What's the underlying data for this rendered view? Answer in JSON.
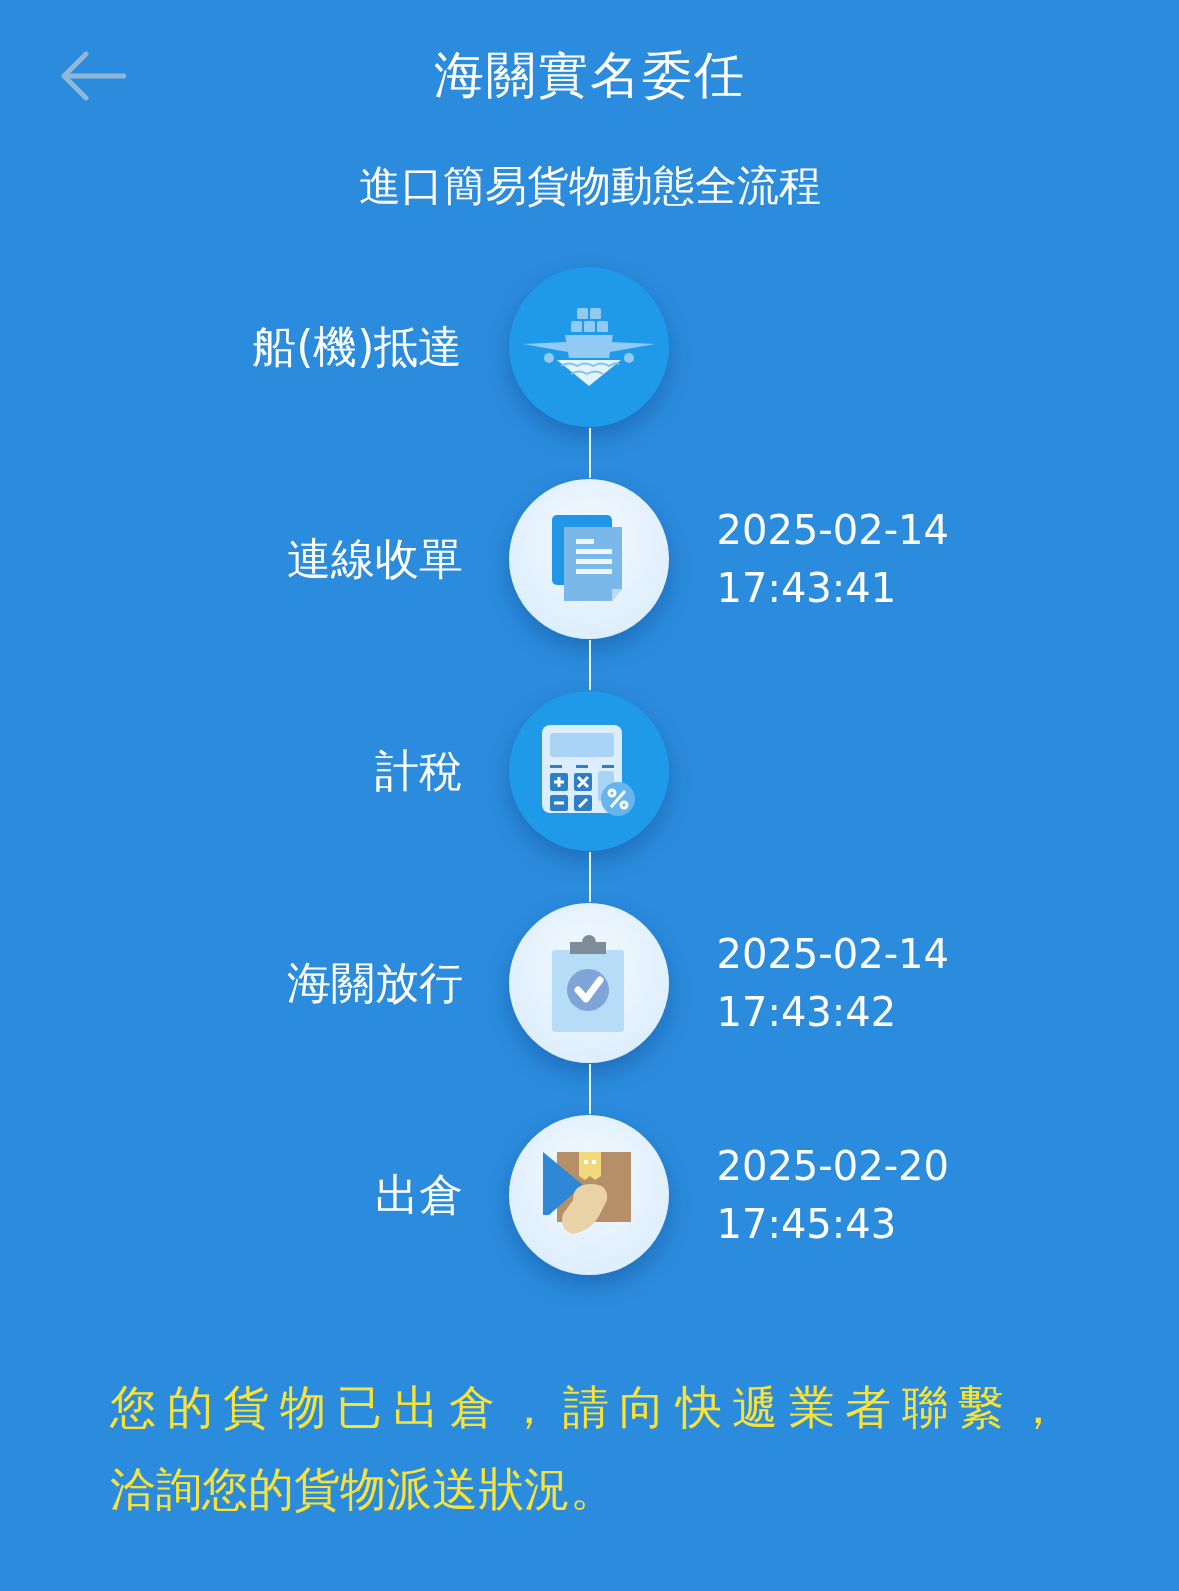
{
  "header": {
    "title": "海關實名委任"
  },
  "subtitle": "進口簡易貨物動態全流程",
  "steps": [
    {
      "kind": "arrival",
      "label": "船(機)抵達",
      "done": false
    },
    {
      "kind": "document",
      "label": "連線收單",
      "done": true,
      "date": "2025-02-14",
      "time": "17:43:41"
    },
    {
      "kind": "tax",
      "label": "計稅",
      "done": false
    },
    {
      "kind": "release",
      "label": "海關放行",
      "done": true,
      "date": "2025-02-14",
      "time": "17:43:42"
    },
    {
      "kind": "pickup",
      "label": "出倉",
      "done": true,
      "date": "2025-02-20",
      "time": "17:45:43"
    }
  ],
  "message": [
    "您的貨物已出倉，請向快遞業者聯繫，",
    "洽詢您的貨物派送狀況。"
  ]
}
